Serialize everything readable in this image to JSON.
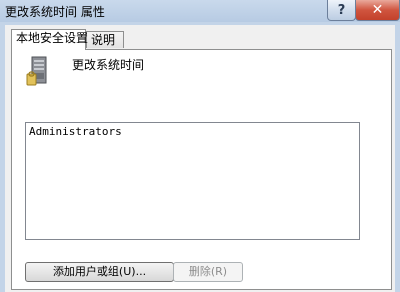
{
  "window": {
    "title": "更改系统时间 属性",
    "help_label": "?",
    "close_label": "✕"
  },
  "tabs": [
    {
      "label": "本地安全设置",
      "active": true
    },
    {
      "label": "说明",
      "active": false
    }
  ],
  "policy": {
    "icon": "server-icon",
    "name": "更改系统时间"
  },
  "list": {
    "items": [
      "Administrators"
    ]
  },
  "buttons": {
    "add_label": "添加用户或组(U)...",
    "remove_label": "删除(R)"
  }
}
